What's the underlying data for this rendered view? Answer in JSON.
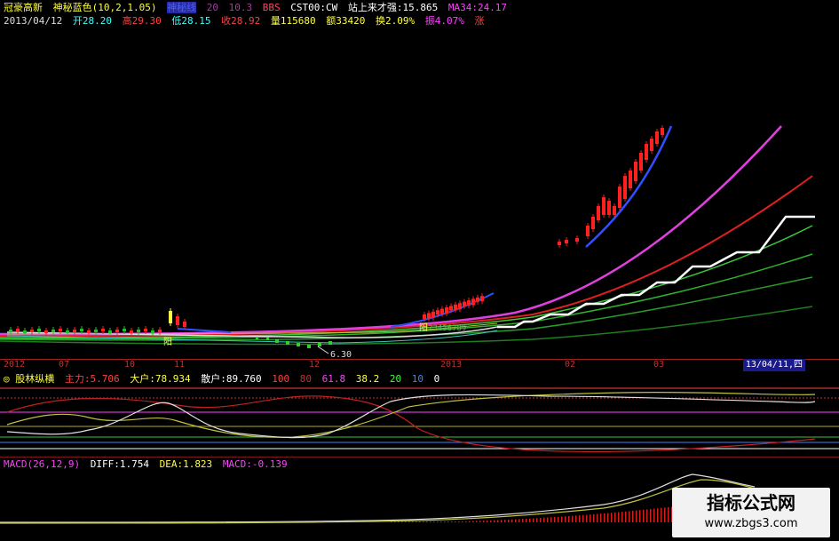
{
  "header": {
    "name": "冠豪高新",
    "indicator": "神秘蓝色(10,2,1.05)",
    "line1_legend": [
      {
        "text": "神秘线",
        "color": "#4060ff",
        "bg": "#2a2aa0"
      },
      {
        "text": "20",
        "color": "#a040a0"
      },
      {
        "text": "10.3",
        "color": "#a040a0"
      },
      {
        "text": "BBS",
        "color": "#ff4060"
      },
      {
        "text": "CST00:CW",
        "color": "#ffffff"
      },
      {
        "text": "站上来才强:15.865",
        "color": "#ffffff"
      },
      {
        "text": "MA34:24.17",
        "color": "#ff40ff"
      }
    ],
    "date": "2013/04/12",
    "open": "开28.20",
    "high": "高29.30",
    "low": "低28.15",
    "close": "收28.92",
    "volume": "量115680",
    "amount": "额33420",
    "turnover": "换2.09%",
    "amplitude": "振4.07%",
    "trend": "涨"
  },
  "main_chart": {
    "price_label": "6.30",
    "left_mark": "阳",
    "mid_mark": "阳",
    "seq_label": "23456789",
    "candles_up_color": "#ff2020",
    "candles_down_color": "#20c020"
  },
  "xaxis": {
    "ticks": [
      "2012",
      "07",
      "10",
      "11",
      "12",
      "2013",
      "02",
      "03"
    ],
    "date_label": "13/04/11,四"
  },
  "indicator_header": {
    "name": "股林纵横",
    "main_force": "主力:5.706",
    "big_holder": "大户:78.934",
    "retail": "散户:89.760",
    "levels": [
      "100",
      "80",
      "61.8",
      "38.2",
      "20",
      "10",
      "0"
    ],
    "level_colors": [
      "#ff4040",
      "#c03030",
      "#ff40ff",
      "#ffff40",
      "#40ff40",
      "#4080ff",
      "#ffffff"
    ]
  },
  "macd_header": {
    "name": "MACD(26,12,9)",
    "diff": "DIFF:1.754",
    "dea": "DEA:1.823",
    "macd": "MACD:-0.139"
  },
  "watermark": {
    "title": "指标公式网",
    "url": "www.zbgs3.com"
  }
}
